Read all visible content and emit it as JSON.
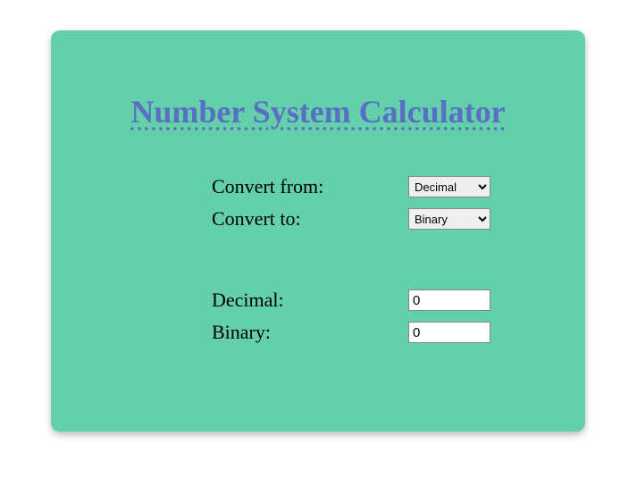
{
  "title": "Number System Calculator",
  "convertFrom": {
    "label": "Convert from:",
    "selected": "Decimal"
  },
  "convertTo": {
    "label": "Convert to:",
    "selected": "Binary"
  },
  "inputFrom": {
    "label": "Decimal:",
    "value": "0"
  },
  "inputTo": {
    "label": "Binary:",
    "value": "0"
  }
}
